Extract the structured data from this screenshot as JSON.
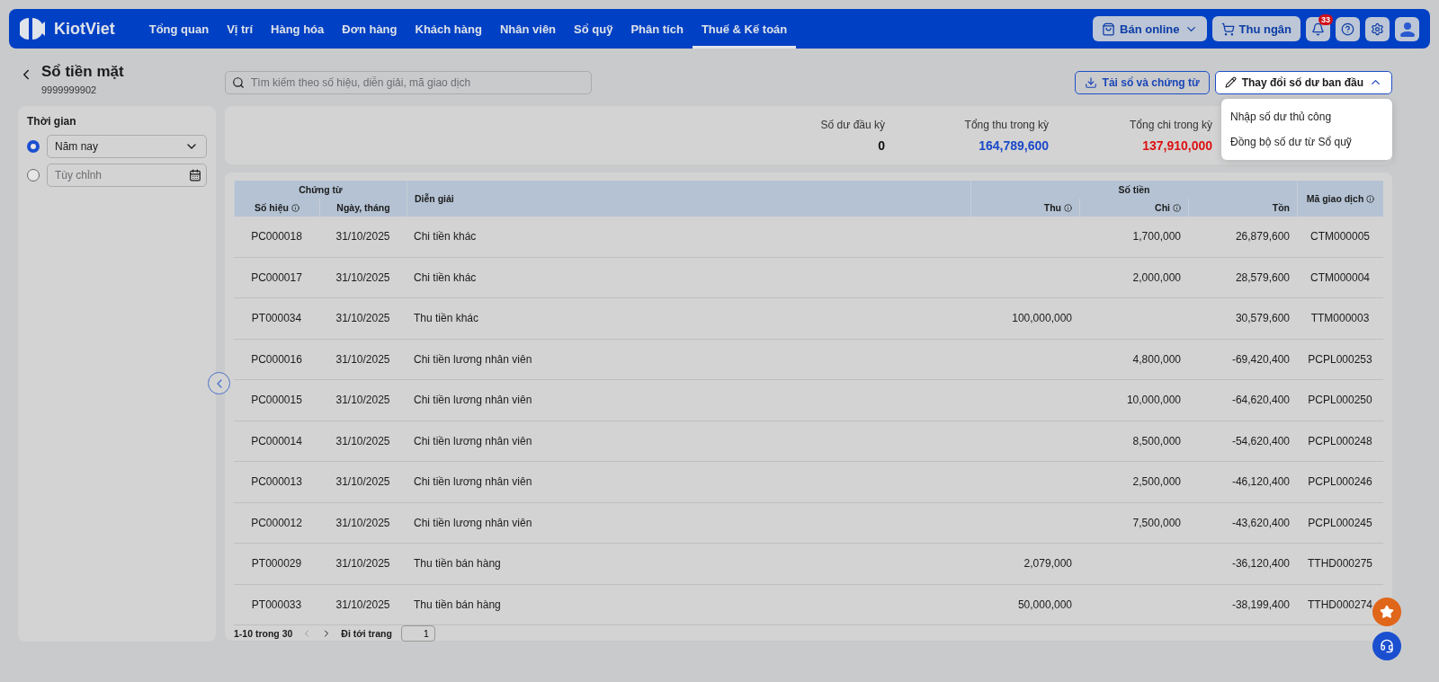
{
  "nav": {
    "logo": "KiotViet",
    "items": [
      {
        "label": "Tổng quan",
        "selected": false
      },
      {
        "label": "Vị trí",
        "selected": false
      },
      {
        "label": "Hàng hóa",
        "selected": false
      },
      {
        "label": "Đơn hàng",
        "selected": false
      },
      {
        "label": "Khách hàng",
        "selected": false
      },
      {
        "label": "Nhân viên",
        "selected": false
      },
      {
        "label": "Sổ quỹ",
        "selected": false
      },
      {
        "label": "Phân tích",
        "selected": false
      },
      {
        "label": "Thuế & Kế toán",
        "selected": true
      }
    ],
    "online_button": "Bán online",
    "cashier_button": "Thu ngân",
    "notification_count": "33"
  },
  "header": {
    "title": "Sổ tiền mặt",
    "subtitle": "9999999902"
  },
  "search": {
    "placeholder": "Tìm kiếm theo số hiệu, diễn giải, mã giao dịch"
  },
  "download_button": "Tải sổ và chứng từ",
  "balance_button": {
    "label": "Thay đổi số dư ban đầu",
    "expanded": true
  },
  "balance_menu": [
    "Nhập số dư thủ công",
    "Đồng bộ số dư từ Sổ quỹ"
  ],
  "filters": {
    "title": "Thời gian",
    "options": [
      {
        "kind": "select",
        "value": "Năm nay",
        "selected": true
      },
      {
        "kind": "date",
        "placeholder": "Tùy chỉnh",
        "selected": false
      }
    ]
  },
  "summary": [
    {
      "label": "Số dư đầu kỳ",
      "value": "0",
      "color": "#111111"
    },
    {
      "label": "Tổng thu trong kỳ",
      "value": "164,789,600",
      "color": "#1a49c8"
    },
    {
      "label": "Tổng chi trong kỳ",
      "value": "137,910,000",
      "color": "#dd1111"
    }
  ],
  "table": {
    "groups": [
      "Chứng từ",
      "Số tiền"
    ],
    "columns": [
      {
        "label": "Số hiệu",
        "info": true
      },
      {
        "label": "Ngày, tháng",
        "info": false
      },
      {
        "label": "Diễn giải",
        "info": false
      },
      {
        "label": "Thu",
        "info": true
      },
      {
        "label": "Chi",
        "info": true
      },
      {
        "label": "Tồn",
        "info": false
      },
      {
        "label": "Mã giao dịch",
        "info": true
      }
    ],
    "rows": [
      [
        "PC000018",
        "31/10/2025",
        "Chi tiền khác",
        "",
        "1,700,000",
        "26,879,600",
        "CTM000005"
      ],
      [
        "PC000017",
        "31/10/2025",
        "Chi tiền khác",
        "",
        "2,000,000",
        "28,579,600",
        "CTM000004"
      ],
      [
        "PT000034",
        "31/10/2025",
        "Thu tiền khác",
        "100,000,000",
        "",
        "30,579,600",
        "TTM000003"
      ],
      [
        "PC000016",
        "31/10/2025",
        "Chi tiền lương nhân viên",
        "",
        "4,800,000",
        "-69,420,400",
        "PCPL000253"
      ],
      [
        "PC000015",
        "31/10/2025",
        "Chi tiền lương nhân viên",
        "",
        "10,000,000",
        "-64,620,400",
        "PCPL000250"
      ],
      [
        "PC000014",
        "31/10/2025",
        "Chi tiền lương nhân viên",
        "",
        "8,500,000",
        "-54,620,400",
        "PCPL000248"
      ],
      [
        "PC000013",
        "31/10/2025",
        "Chi tiền lương nhân viên",
        "",
        "2,500,000",
        "-46,120,400",
        "PCPL000246"
      ],
      [
        "PC000012",
        "31/10/2025",
        "Chi tiền lương nhân viên",
        "",
        "7,500,000",
        "-43,620,400",
        "PCPL000245"
      ],
      [
        "PT000029",
        "31/10/2025",
        "Thu tiền bán hàng",
        "2,079,000",
        "",
        "-36,120,400",
        "TTHD000275"
      ],
      [
        "PT000033",
        "31/10/2025",
        "Thu tiền bán hàng",
        "50,000,000",
        "",
        "-38,199,400",
        "TTHD000274"
      ]
    ]
  },
  "pagination": {
    "range": "1-10 trong 30",
    "goto_label": "Đi tới trang",
    "page": "1"
  }
}
